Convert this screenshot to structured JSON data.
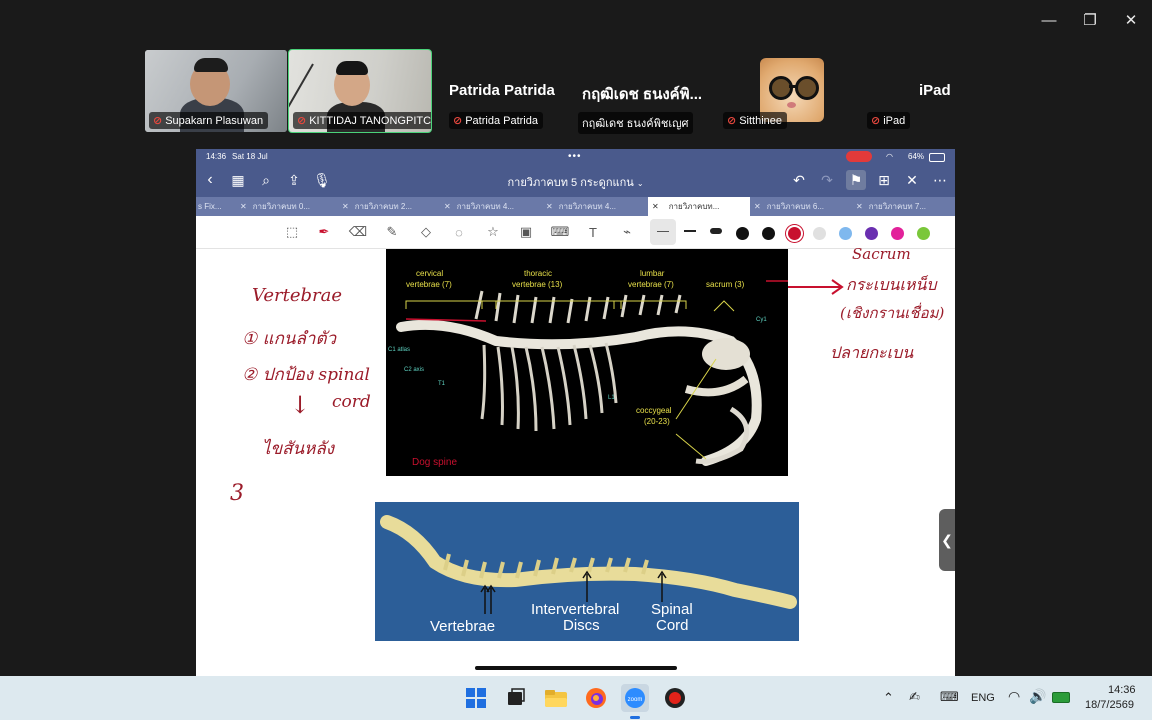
{
  "window_controls": {
    "minimize": "—",
    "maximize": "❐",
    "close": "✕"
  },
  "participants": {
    "tiles": [
      {
        "name": "Supakarn Plasuwan"
      },
      {
        "name": "KITTIDAJ TANONGPITCHA..."
      },
      {
        "big_name": "Patrida Patrida",
        "name": "Patrida Patrida"
      },
      {
        "big_name": "กฤฒิเดช ธนงค์พิ...",
        "name": "กฤฒิเดช ธนงค์พิชเญศ"
      },
      {
        "name": "Sitthinee"
      },
      {
        "big_name": "iPad",
        "name": "iPad"
      }
    ]
  },
  "ipad": {
    "status": {
      "time": "14:36",
      "date": "Sat 18 Jul",
      "battery": "64%",
      "dots": "•••"
    },
    "doc_title": "กายวิภาคบท 5 กระดูกแกน",
    "tabs": [
      {
        "label": "s Fix..."
      },
      {
        "label": "กายวิภาคบท 0..."
      },
      {
        "label": "กายวิภาคบท 2..."
      },
      {
        "label": "กายวิภาคบท 4..."
      },
      {
        "label": "กายวิภาคบท 4..."
      },
      {
        "label": "กายวิภาคบท..."
      },
      {
        "label": "กายวิภาคบท 6..."
      },
      {
        "label": "กายวิภาคบท 7..."
      }
    ],
    "colors": [
      "#111111",
      "#111111",
      "#c8102e",
      "#e0e0e0",
      "#7fb8ee",
      "#6a2fb0",
      "#e2219a",
      "#7ac73a"
    ],
    "selected_color": "#c8102e",
    "handwriting": {
      "vertebrae": "Vertebrae",
      "item1": "① แกนลำตัว",
      "item2": "② ปกป้อง spinal",
      "item2b": "cord",
      "arrow": "↓",
      "item2c": "ไขสันหลัง",
      "item3": "3",
      "right1": "Sacrum",
      "right2": "กระเบนเหน็บ",
      "right3": "(เชิงกรานเชื่อม)",
      "right4": "ปลายกะเบน"
    },
    "figure1": {
      "labels": {
        "cervical": "cervical",
        "cervical2": "vertebrae (7)",
        "thoracic": "thoracic",
        "thoracic2": "vertebrae (13)",
        "lumbar": "lumbar",
        "lumbar2": "vertebrae (7)",
        "sacrum": "sacrum (3)",
        "c1": "C1 atlas",
        "c2": "C2 axis",
        "t1": "T1",
        "l1": "L1",
        "cy1": "Cy1",
        "coccygeal": "coccygeal",
        "coccygeal2": "(20-23)",
        "caption": "Dog spine"
      }
    },
    "figure2": {
      "labels": {
        "vertebrae": "Vertebrae",
        "inter1": "Intervertebral",
        "inter2": "Discs",
        "spinal1": "Spinal",
        "spinal2": "Cord"
      }
    }
  },
  "taskbar": {
    "lang": "ENG",
    "time": "14:36",
    "date": "18/7/2569"
  }
}
